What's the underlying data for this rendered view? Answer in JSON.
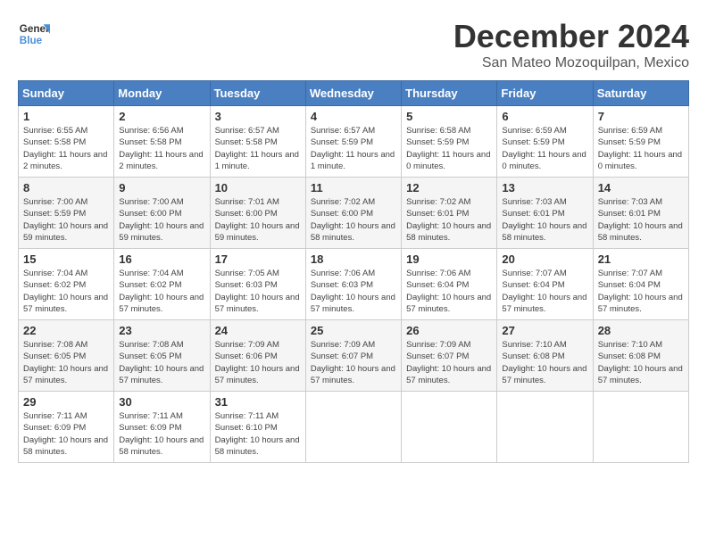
{
  "header": {
    "logo_line1": "General",
    "logo_line2": "Blue",
    "month": "December 2024",
    "location": "San Mateo Mozoquilpan, Mexico"
  },
  "weekdays": [
    "Sunday",
    "Monday",
    "Tuesday",
    "Wednesday",
    "Thursday",
    "Friday",
    "Saturday"
  ],
  "weeks": [
    [
      {
        "day": "1",
        "sunrise": "6:55 AM",
        "sunset": "5:58 PM",
        "daylight": "11 hours and 2 minutes."
      },
      {
        "day": "2",
        "sunrise": "6:56 AM",
        "sunset": "5:58 PM",
        "daylight": "11 hours and 2 minutes."
      },
      {
        "day": "3",
        "sunrise": "6:57 AM",
        "sunset": "5:58 PM",
        "daylight": "11 hours and 1 minute."
      },
      {
        "day": "4",
        "sunrise": "6:57 AM",
        "sunset": "5:59 PM",
        "daylight": "11 hours and 1 minute."
      },
      {
        "day": "5",
        "sunrise": "6:58 AM",
        "sunset": "5:59 PM",
        "daylight": "11 hours and 0 minutes."
      },
      {
        "day": "6",
        "sunrise": "6:59 AM",
        "sunset": "5:59 PM",
        "daylight": "11 hours and 0 minutes."
      },
      {
        "day": "7",
        "sunrise": "6:59 AM",
        "sunset": "5:59 PM",
        "daylight": "11 hours and 0 minutes."
      }
    ],
    [
      {
        "day": "8",
        "sunrise": "7:00 AM",
        "sunset": "5:59 PM",
        "daylight": "10 hours and 59 minutes."
      },
      {
        "day": "9",
        "sunrise": "7:00 AM",
        "sunset": "6:00 PM",
        "daylight": "10 hours and 59 minutes."
      },
      {
        "day": "10",
        "sunrise": "7:01 AM",
        "sunset": "6:00 PM",
        "daylight": "10 hours and 59 minutes."
      },
      {
        "day": "11",
        "sunrise": "7:02 AM",
        "sunset": "6:00 PM",
        "daylight": "10 hours and 58 minutes."
      },
      {
        "day": "12",
        "sunrise": "7:02 AM",
        "sunset": "6:01 PM",
        "daylight": "10 hours and 58 minutes."
      },
      {
        "day": "13",
        "sunrise": "7:03 AM",
        "sunset": "6:01 PM",
        "daylight": "10 hours and 58 minutes."
      },
      {
        "day": "14",
        "sunrise": "7:03 AM",
        "sunset": "6:01 PM",
        "daylight": "10 hours and 58 minutes."
      }
    ],
    [
      {
        "day": "15",
        "sunrise": "7:04 AM",
        "sunset": "6:02 PM",
        "daylight": "10 hours and 57 minutes."
      },
      {
        "day": "16",
        "sunrise": "7:04 AM",
        "sunset": "6:02 PM",
        "daylight": "10 hours and 57 minutes."
      },
      {
        "day": "17",
        "sunrise": "7:05 AM",
        "sunset": "6:03 PM",
        "daylight": "10 hours and 57 minutes."
      },
      {
        "day": "18",
        "sunrise": "7:06 AM",
        "sunset": "6:03 PM",
        "daylight": "10 hours and 57 minutes."
      },
      {
        "day": "19",
        "sunrise": "7:06 AM",
        "sunset": "6:04 PM",
        "daylight": "10 hours and 57 minutes."
      },
      {
        "day": "20",
        "sunrise": "7:07 AM",
        "sunset": "6:04 PM",
        "daylight": "10 hours and 57 minutes."
      },
      {
        "day": "21",
        "sunrise": "7:07 AM",
        "sunset": "6:04 PM",
        "daylight": "10 hours and 57 minutes."
      }
    ],
    [
      {
        "day": "22",
        "sunrise": "7:08 AM",
        "sunset": "6:05 PM",
        "daylight": "10 hours and 57 minutes."
      },
      {
        "day": "23",
        "sunrise": "7:08 AM",
        "sunset": "6:05 PM",
        "daylight": "10 hours and 57 minutes."
      },
      {
        "day": "24",
        "sunrise": "7:09 AM",
        "sunset": "6:06 PM",
        "daylight": "10 hours and 57 minutes."
      },
      {
        "day": "25",
        "sunrise": "7:09 AM",
        "sunset": "6:07 PM",
        "daylight": "10 hours and 57 minutes."
      },
      {
        "day": "26",
        "sunrise": "7:09 AM",
        "sunset": "6:07 PM",
        "daylight": "10 hours and 57 minutes."
      },
      {
        "day": "27",
        "sunrise": "7:10 AM",
        "sunset": "6:08 PM",
        "daylight": "10 hours and 57 minutes."
      },
      {
        "day": "28",
        "sunrise": "7:10 AM",
        "sunset": "6:08 PM",
        "daylight": "10 hours and 57 minutes."
      }
    ],
    [
      {
        "day": "29",
        "sunrise": "7:11 AM",
        "sunset": "6:09 PM",
        "daylight": "10 hours and 58 minutes."
      },
      {
        "day": "30",
        "sunrise": "7:11 AM",
        "sunset": "6:09 PM",
        "daylight": "10 hours and 58 minutes."
      },
      {
        "day": "31",
        "sunrise": "7:11 AM",
        "sunset": "6:10 PM",
        "daylight": "10 hours and 58 minutes."
      },
      null,
      null,
      null,
      null
    ]
  ],
  "labels": {
    "sunrise": "Sunrise: ",
    "sunset": "Sunset: ",
    "daylight": "Daylight: "
  }
}
